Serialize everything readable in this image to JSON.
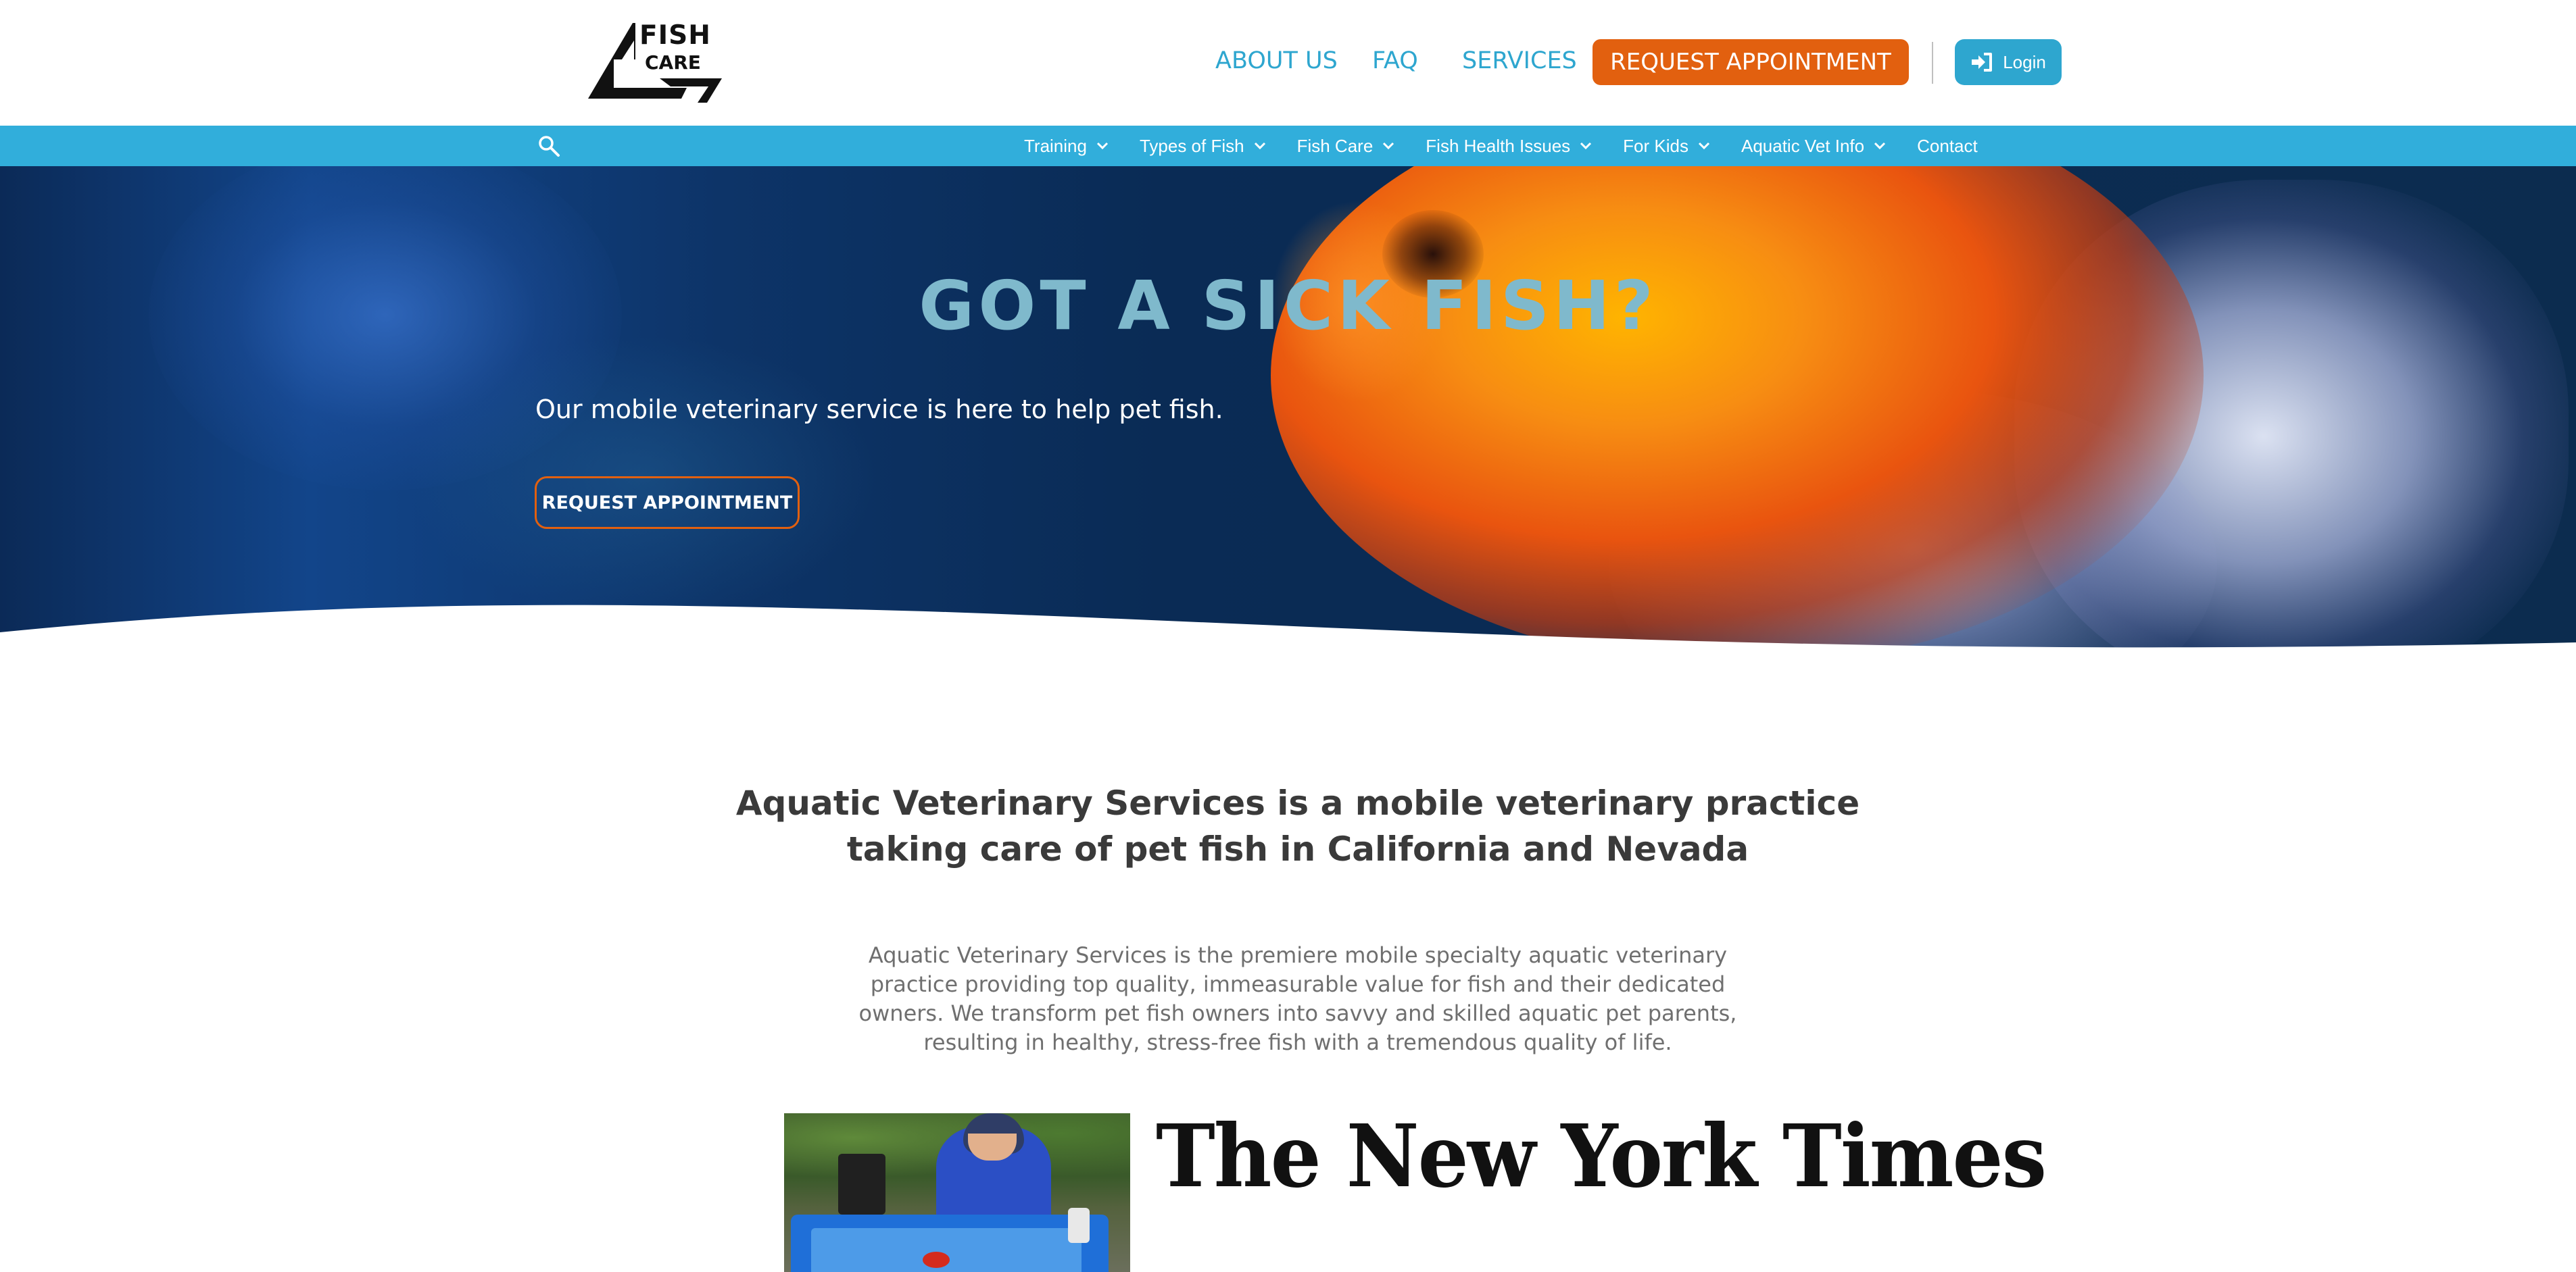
{
  "header": {
    "logo": {
      "line1": "FISH",
      "line2": "CARE"
    },
    "nav": {
      "about": "ABOUT US",
      "faq": "FAQ",
      "services": "SERVICES"
    },
    "request_button": "REQUEST APPOINTMENT",
    "login_button": "Login"
  },
  "menubar": {
    "items": [
      {
        "label": "Training",
        "has_dropdown": true
      },
      {
        "label": "Types of Fish",
        "has_dropdown": true
      },
      {
        "label": "Fish Care",
        "has_dropdown": true
      },
      {
        "label": "Fish Health Issues",
        "has_dropdown": true
      },
      {
        "label": "For Kids",
        "has_dropdown": true
      },
      {
        "label": "Aquatic Vet Info",
        "has_dropdown": true
      },
      {
        "label": "Contact",
        "has_dropdown": false
      }
    ]
  },
  "hero": {
    "title": "GOT A SICK FISH?",
    "subtitle": "Our mobile veterinary service is here to help pet fish.",
    "button": "REQUEST APPOINTMENT"
  },
  "intro": {
    "heading": "Aquatic Veterinary Services is a mobile veterinary practice taking care of pet fish in California and Nevada",
    "paragraph": "Aquatic Veterinary Services is the premiere mobile specialty aquatic veterinary practice providing top quality, immeasurable value for fish and their dedicated owners. We transform pet fish owners into savvy and skilled aquatic pet parents, resulting in healthy, stress-free fish with a tremendous quality of life."
  },
  "press": {
    "logo_text": "The New York Times"
  },
  "colors": {
    "accent_blue": "#2ea6cf",
    "menubar_blue": "#31aedb",
    "accent_orange": "#e2600f",
    "hero_title": "#7fb9cc"
  },
  "icons": {
    "search": "search-icon",
    "login": "login-arrow-icon",
    "dropdown": "chevron-down-icon"
  }
}
